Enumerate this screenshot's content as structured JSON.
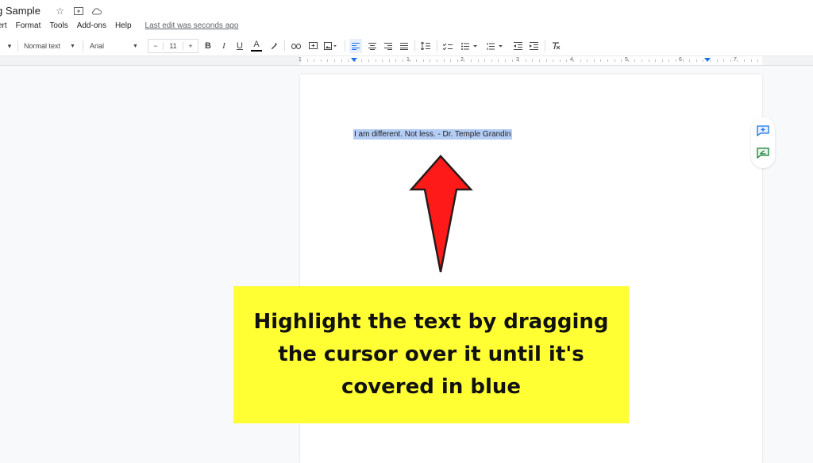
{
  "header": {
    "doc_title": "g Sample",
    "icons": [
      "star-icon",
      "move-to-folder-icon",
      "cloud-status-icon"
    ]
  },
  "menu": {
    "items": [
      "ert",
      "Format",
      "Tools",
      "Add-ons",
      "Help"
    ],
    "last_edit": "Last edit was seconds ago"
  },
  "toolbar": {
    "zoom_dropdown_arrow": "▾",
    "style_select": "Normal text",
    "font_select": "Arial",
    "font_size": "11",
    "decrease_label": "−",
    "increase_label": "+",
    "bold": "B",
    "italic": "I",
    "underline": "U",
    "text_color": "A",
    "clear_formatting": "Tx"
  },
  "ruler": {
    "labels": [
      "1",
      "1",
      "2",
      "3",
      "4",
      "5",
      "6",
      "7"
    ]
  },
  "document": {
    "selected_text": "I am different. Not less. - Dr. Temple Grandin",
    "highlight_color": "#b3cdf5"
  },
  "side_actions": [
    "add-comment-icon",
    "suggest-edits-icon"
  ],
  "annotation": {
    "callout_text": "Highlight the text by dragging the cursor over it until it's covered in blue",
    "callout_color": "#ffff33",
    "arrow_color": "#ff1a1a"
  }
}
